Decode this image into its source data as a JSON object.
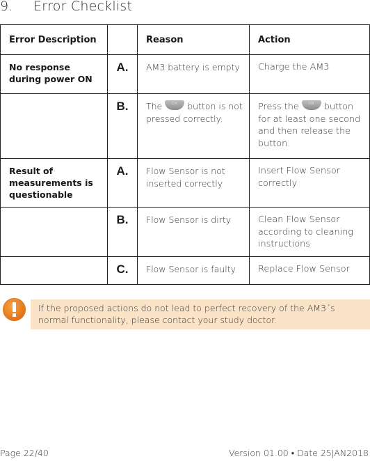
{
  "section": {
    "number": "9.",
    "title": "Error Checklist"
  },
  "table": {
    "headers": [
      "Error Description",
      "",
      "Reason",
      "Action"
    ],
    "rows": [
      {
        "description": "No response during power ON",
        "letter": "A.",
        "reason": "AM3 battery is empty",
        "action": "Charge the AM3"
      },
      {
        "description": "",
        "letter": "B.",
        "reason_pre": "The",
        "reason_post": "button is not pressed correctly.",
        "action_pre": "Press the",
        "action_post": "button for at least one second and then release the button.",
        "button_icon_label": "OK"
      },
      {
        "description": "Result of measurements is questionable",
        "letter": "A.",
        "reason": "Flow Sensor is not inserted correctly",
        "action": "Insert Flow Sensor correctly"
      },
      {
        "description": "",
        "letter": "B.",
        "reason": "Flow Sensor is dirty",
        "action": "Clean Flow Sensor according to cleaning instructions"
      },
      {
        "description": "",
        "letter": "C.",
        "reason": "Flow Sensor is faulty",
        "action": "Replace Flow Sensor"
      }
    ]
  },
  "note": {
    "icon": "warning-exclamation-icon",
    "text": "If the proposed actions do not lead to perfect recovery of the AM3´s normal functionality, please contact your study doctor.",
    "background_color": "#fbe3c7",
    "icon_color": "#e27416"
  },
  "footer": {
    "page": "Page 22/40",
    "version": "Version 01.00 • Date 25JAN2018"
  }
}
